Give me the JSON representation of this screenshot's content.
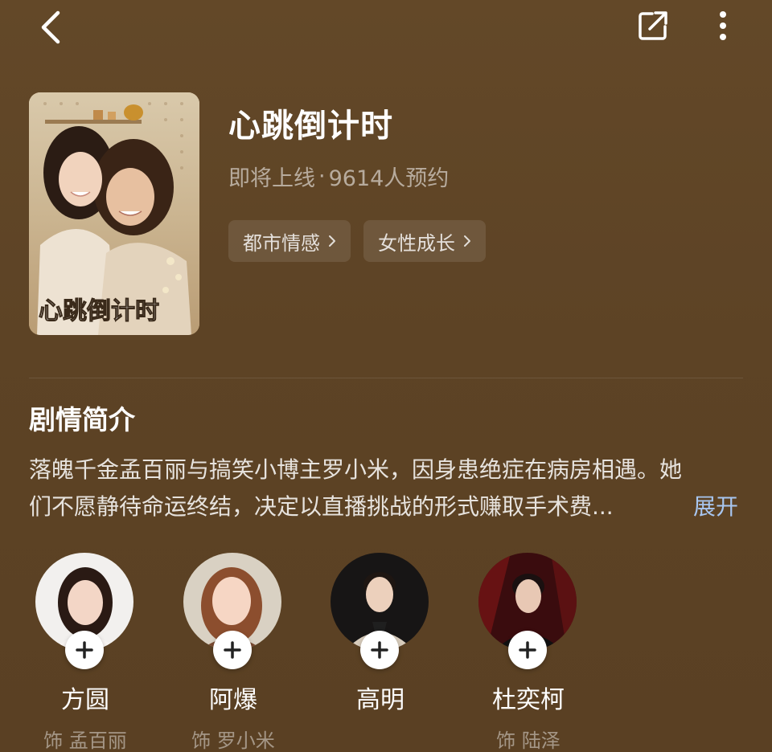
{
  "header": {
    "back_icon": "chevron-left-icon",
    "share_icon": "share-icon",
    "more_icon": "more-vertical-icon"
  },
  "show": {
    "title": "心跳倒计时",
    "status": "即将上线",
    "separator": "·",
    "reservations": "9614人预约",
    "poster_text": "心跳倒计时"
  },
  "tags": [
    {
      "label": "都市情感"
    },
    {
      "label": "女性成长"
    }
  ],
  "synopsis": {
    "title": "剧情简介",
    "line1": "落魄千金孟百丽与搞笑小博主罗小米，因身患绝症在病房相遇。她",
    "line2": "们不愿静待命运终结，决定以直播挑战的形式赚取手术费...",
    "expand_label": "展开"
  },
  "cast": [
    {
      "name": "方圆",
      "role": "饰 孟百丽"
    },
    {
      "name": "阿爆",
      "role": "饰 罗小米"
    },
    {
      "name": "高明",
      "role": ""
    },
    {
      "name": "杜奕柯",
      "role": "饰 陆泽"
    }
  ],
  "colors": {
    "background": "#5e4426",
    "expand_link": "#a8c6f0"
  }
}
